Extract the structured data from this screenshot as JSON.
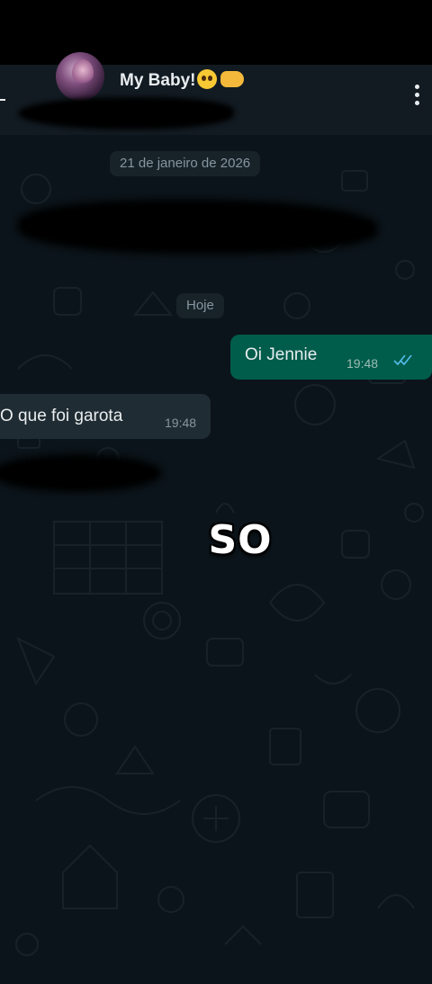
{
  "header": {
    "contact_name": "My Baby!",
    "avatar": "contact-avatar",
    "back_icon": "back-arrow-icon",
    "menu_icon": "more-vertical-icon"
  },
  "chat": {
    "date_divider": "21 de janeiro de 2026",
    "today_divider": "Hoje",
    "messages": [
      {
        "direction": "out",
        "text": "Oi Jennie",
        "time": "19:48",
        "status": "read-double-check"
      },
      {
        "direction": "in",
        "text": "O que foi garota",
        "time": "19:48"
      }
    ]
  },
  "overlay": {
    "caption": "SO"
  },
  "colors": {
    "header_bg": "#121b22",
    "chat_bg": "#0b141a",
    "outgoing_bubble": "#005c4b",
    "incoming_bubble": "#202c33",
    "read_ticks": "#53bdeb"
  }
}
